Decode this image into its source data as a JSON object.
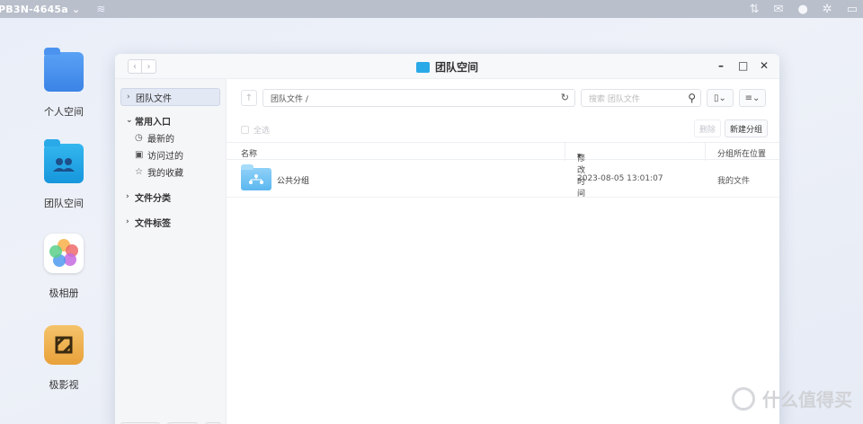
{
  "topbar": {
    "device_name": "PB3N-4645a",
    "icons": [
      "wifi-icon",
      "transfer-icon",
      "message-icon",
      "user-icon",
      "gear-icon",
      "menu-icon"
    ]
  },
  "desktop": {
    "icons": [
      {
        "label": "个人空间",
        "icon": "personal-folder-icon"
      },
      {
        "label": "团队空间",
        "icon": "team-folder-icon"
      },
      {
        "label": "极相册",
        "icon": "photos-app-icon"
      },
      {
        "label": "极影视",
        "icon": "video-app-icon"
      }
    ]
  },
  "window": {
    "title": "团队空间",
    "controls": {
      "minimize": "–",
      "maximize": "□",
      "close": "✕"
    }
  },
  "sidebar": {
    "team_files": "团队文件",
    "quick_access": {
      "label": "常用入口",
      "items": [
        {
          "label": "最新的",
          "icon": "clock-icon"
        },
        {
          "label": "访问过的",
          "icon": "history-icon"
        },
        {
          "label": "我的收藏",
          "icon": "star-icon"
        }
      ]
    },
    "categories": "文件分类",
    "tags": "文件标签"
  },
  "toolbar": {
    "path": "团队文件 /",
    "search_placeholder": "搜索 团队文件"
  },
  "actions": {
    "select_all": "全选",
    "delete": "删除",
    "new_group": "新建分组"
  },
  "table": {
    "headers": {
      "name": "名称",
      "modified": "修改时间",
      "location": "分组所在位置"
    },
    "rows": [
      {
        "name": "公共分组",
        "modified": "2023-08-05 13:01:07",
        "location": "我的文件"
      }
    ]
  },
  "watermark": "什么值得买"
}
